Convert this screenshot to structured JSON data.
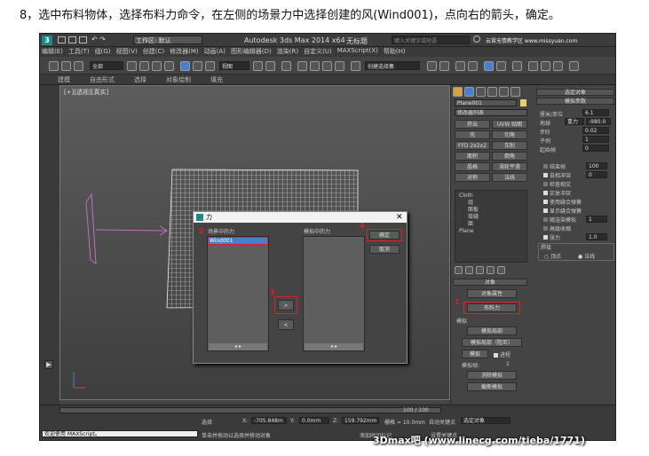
{
  "caption": "8，选中布料物体，选择布料力命令，在左侧的场景力中选择创建的风(Wind001)，点向右的箭头，确定。",
  "titlebar": {
    "workspace": "工作区: 默认",
    "app_title": "Autodesk 3ds Max  2014 x64",
    "doc_title": "无标题",
    "search_placeholder": "键入关键字或短语",
    "watermark_text": "云霄无情教学区 www.missyuan.com"
  },
  "menu": [
    "编辑(E)",
    "工具(T)",
    "组(G)",
    "视图(V)",
    "创建(C)",
    "修改器(M)",
    "动画(A)",
    "图形编辑器(D)",
    "渲染(R)",
    "自定义(U)",
    "MAXScript(X)",
    "帮助(H)"
  ],
  "toolbar": {
    "selection_filter": "全部",
    "ref_coord": "视图",
    "named_selection": "创建选择集"
  },
  "ribbon_tabs": [
    "建模",
    "自由形式",
    "选择",
    "对象绘制",
    "填充"
  ],
  "viewport_label": "[+][透视][真实]",
  "cmd_panel": {
    "object_name": "Plane001",
    "modifier_list": "修改器列表",
    "grid_buttons": [
      "挤出",
      "UVW 贴图",
      "壳",
      "切角",
      "FFD 2x2x2",
      "车削",
      "面积",
      "倒角",
      "晶格",
      "涡轮平滑",
      "对称",
      "法线"
    ],
    "stack_items": [
      "Cloth",
      "组",
      "面板",
      "接缝",
      "面",
      "Plane"
    ],
    "object_rollout": "对象",
    "object_props_btn": "对象属性",
    "cloth_forces_btn": "布料力",
    "sim_rollout": "模拟",
    "sim_local_btn": "模拟局部",
    "sim_local_damped_btn": "模拟局部（阻尼）",
    "sim_btn": "模拟",
    "progress_label": "进程",
    "sim_frame_label": "模拟帧:",
    "sim_frame_value": "1",
    "erase_btn": "消除模拟",
    "truncate_btn": "截断模拟",
    "right_rollout1": "选定对象",
    "right_rollout2": "模拟参数",
    "params": [
      {
        "label": "厘米/单位",
        "value": "6.1"
      },
      {
        "label": "地球",
        "value": "重力",
        "value2": "-980.0"
      },
      {
        "label": "步阶",
        "value": "0.02"
      },
      {
        "label": "子例",
        "value": "1"
      },
      {
        "label": "起始帧",
        "value": "0"
      }
    ],
    "checks": [
      {
        "label": "结束帧",
        "checked": false,
        "value": "100"
      },
      {
        "label": "自相冲突",
        "checked": true,
        "value": "0"
      },
      {
        "label": "检查相交",
        "checked": false
      },
      {
        "label": "实体冲突",
        "checked": true
      },
      {
        "label": "使用缝合弹簧",
        "checked": true
      },
      {
        "label": "显示缝合弹簧",
        "checked": true
      },
      {
        "label": "随渲染模拟",
        "checked": false,
        "value": "1"
      },
      {
        "label": "高级收缩",
        "checked": false
      },
      {
        "label": "张力",
        "checked": true,
        "value": "1.0"
      }
    ],
    "weld_label": "焊接",
    "weld_opt1": "顶点",
    "weld_opt2": "法线"
  },
  "dialog": {
    "title": "力",
    "scene_forces_label": "场景中的力",
    "sim_forces_label": "模拟中的力",
    "scene_items": [
      "Wind001"
    ],
    "ok": "确定",
    "cancel": "取消",
    "move_right": ">",
    "move_left": "<",
    "step_numbers": [
      "1",
      "2",
      "3",
      "4"
    ]
  },
  "bottom": {
    "timeline": "100 / 100",
    "selection_status": "选择",
    "x_label": "X:",
    "x_value": "-705.848m",
    "y_label": "Y:",
    "y_value": "0.0mm",
    "z_label": "Z:",
    "z_value": "159.792mm",
    "grid": "栅格 = 10.0mm",
    "autokey": "自动关键点",
    "key_mode": "选定对象",
    "maxscript": "欢迎使用 MAXScript。",
    "prompt": "单击并拖动以选择并移动对象",
    "add_time_tag": "添加时间标记",
    "set_key": "设置关键点"
  },
  "footer_watermark": "3Dmax吧  (www.linecg.com/tieba/1771)",
  "colors": {
    "accent_red": "#e02020",
    "selection_blue": "#4a7fd0",
    "viewport_bg": "#4a4a4a"
  }
}
